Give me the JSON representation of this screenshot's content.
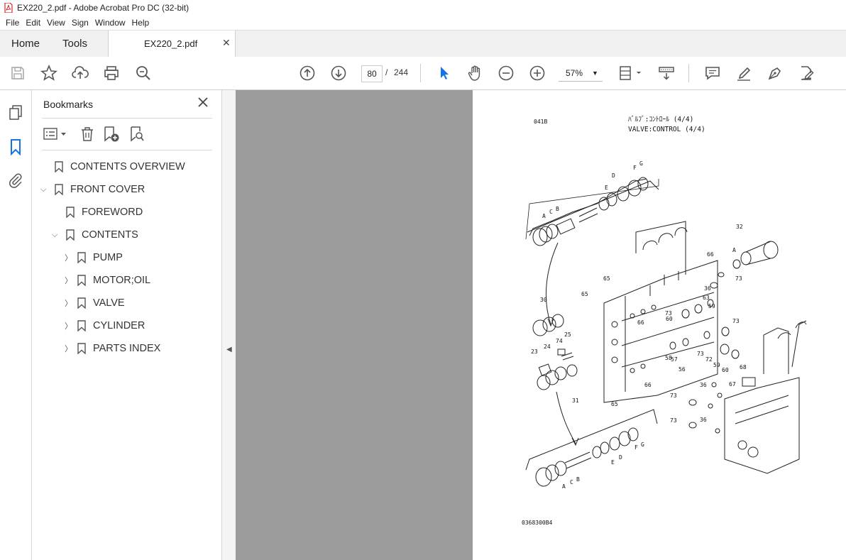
{
  "window": {
    "title": "EX220_2.pdf - Adobe Acrobat Pro DC (32-bit)"
  },
  "menu": [
    "File",
    "Edit",
    "View",
    "Sign",
    "Window",
    "Help"
  ],
  "tabs": {
    "home": "Home",
    "tools": "Tools",
    "document": "EX220_2.pdf"
  },
  "toolbar": {
    "current_page": "80",
    "separator": "/",
    "total_pages": "244",
    "zoom": "57%"
  },
  "bookmarks": {
    "title": "Bookmarks",
    "items": [
      {
        "label": "CONTENTS OVERVIEW"
      },
      {
        "label": "FRONT COVER"
      },
      {
        "label": "FOREWORD"
      },
      {
        "label": "CONTENTS"
      },
      {
        "label": "PUMP"
      },
      {
        "label": "MOTOR;OIL"
      },
      {
        "label": "VALVE"
      },
      {
        "label": "CYLINDER"
      },
      {
        "label": "PARTS INDEX"
      }
    ]
  },
  "document_page": {
    "code": "041B",
    "title_jp": "ﾊﾞﾙﾌﾞ:ｺﾝﾄﾛｰﾙ (4/4)",
    "title_en": "VALVE:CONTROL (4/4)",
    "drawing_no": "0368300B4",
    "callouts": [
      "A",
      "B",
      "C",
      "D",
      "E",
      "F",
      "G",
      "32",
      "66",
      "65",
      "73",
      "36",
      "63",
      "59",
      "60",
      "30",
      "25",
      "74",
      "24",
      "23",
      "31",
      "57",
      "58",
      "56",
      "72",
      "68",
      "67",
      "A",
      "B",
      "C",
      "D",
      "E",
      "F",
      "G"
    ]
  },
  "colors": {
    "accent_blue": "#1473e6",
    "pdf_red": "#e0251b",
    "doc_bg": "#9b9b9b"
  }
}
